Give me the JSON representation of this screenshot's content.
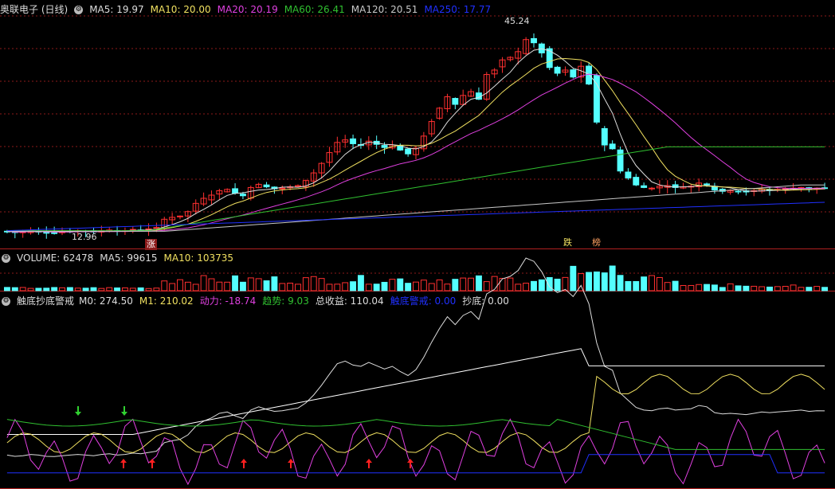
{
  "colors": {
    "ma5": "#dddddd",
    "ma10": "#f0e060",
    "ma20": "#e040e0",
    "ma60": "#30c030",
    "ma120": "#c8c8c8",
    "ma250": "#2030ff",
    "up": "#ff3030",
    "down": "#54ffff",
    "grid": "#8b1a1a",
    "axis": "#b02020"
  },
  "price_panel": {
    "title": "奥联电子 (日线)",
    "ma_labels": [
      {
        "text": "MA5: 19.97",
        "color": "#dddddd"
      },
      {
        "text": "MA10: 20.00",
        "color": "#f0e060"
      },
      {
        "text": "MA20: 20.19",
        "color": "#e040e0"
      },
      {
        "text": "MA60: 26.41",
        "color": "#30c030"
      },
      {
        "text": "MA120: 20.51",
        "color": "#c8c8c8"
      },
      {
        "text": "MA250: 17.77",
        "color": "#2030ff"
      }
    ],
    "high_label": "45.24",
    "low_label": "12.96",
    "markers": {
      "zhang": "涨",
      "die": "跌",
      "bang": "榜"
    }
  },
  "volume_panel": {
    "labels": [
      {
        "text": "VOLUME: 62478",
        "color": "#dddddd"
      },
      {
        "text": "MA5: 99615",
        "color": "#dddddd"
      },
      {
        "text": "MA10: 103735",
        "color": "#f0e060"
      }
    ]
  },
  "indicator_panel": {
    "title": "触底抄底警戒",
    "labels": [
      {
        "text": "M0: 274.50",
        "color": "#dddddd"
      },
      {
        "text": "M1: 210.02",
        "color": "#f0e060"
      },
      {
        "text": "动力: -18.74",
        "color": "#e040e0"
      },
      {
        "text": "趋势: 9.03",
        "color": "#30c030"
      },
      {
        "text": "总收益: 110.04",
        "color": "#dddddd"
      },
      {
        "text": "触底警戒: 0.00",
        "color": "#2030ff"
      },
      {
        "text": "抄底: 0.00",
        "color": "#dddddd"
      }
    ]
  },
  "chart_data": {
    "type": "candlestick",
    "closes": [
      13.2,
      13.0,
      13.1,
      13.3,
      13.2,
      13.0,
      12.96,
      13.1,
      13.2,
      13.3,
      13.2,
      13.1,
      13.3,
      13.4,
      13.2,
      13.3,
      13.5,
      13.4,
      13.6,
      13.8,
      15.1,
      15.4,
      15.6,
      16.3,
      17.6,
      18.4,
      18.9,
      19.6,
      19.8,
      19.2,
      18.8,
      20.1,
      20.6,
      20.2,
      19.9,
      20.0,
      20.2,
      20.4,
      21.2,
      22.4,
      23.9,
      25.6,
      27.2,
      27.6,
      27.0,
      26.8,
      27.4,
      26.9,
      26.4,
      26.8,
      26.0,
      25.4,
      26.3,
      28.2,
      30.5,
      32.6,
      34.4,
      33.2,
      34.6,
      35.2,
      34.0,
      37.9,
      38.6,
      40.2,
      40.6,
      41.5,
      43.4,
      42.9,
      41.3,
      39.0,
      38.1,
      38.6,
      37.5,
      39.2,
      36.4,
      30.4,
      26.8,
      26.2,
      22.7,
      21.6,
      20.5,
      20.1,
      20.0,
      20.3,
      20.4,
      20.1,
      20.2,
      20.3,
      20.8,
      20.6,
      19.7,
      19.5,
      19.6,
      19.5,
      19.4,
      19.6,
      19.8,
      19.7,
      19.8,
      19.9,
      20.0,
      20.1,
      19.9,
      20.0,
      19.97
    ],
    "signals": {
      "buy_arrows": 6,
      "green_arrows": 2
    }
  }
}
